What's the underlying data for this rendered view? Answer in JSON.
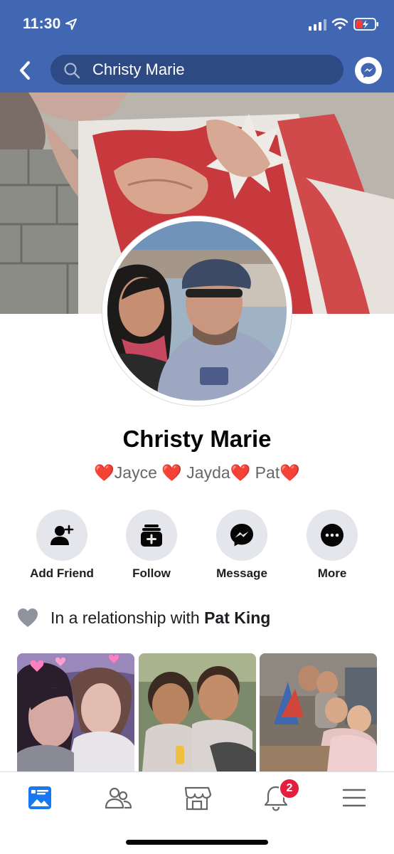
{
  "status_bar": {
    "time": "11:30"
  },
  "header": {
    "search_value": "Christy Marie"
  },
  "profile": {
    "name": "Christy Marie",
    "bio": "❤️Jayce ❤️ Jayda❤️ Pat❤️"
  },
  "actions": [
    {
      "label": "Add Friend",
      "icon": "add-friend-icon"
    },
    {
      "label": "Follow",
      "icon": "follow-icon"
    },
    {
      "label": "Message",
      "icon": "messenger-icon"
    },
    {
      "label": "More",
      "icon": "more-icon"
    }
  ],
  "relationship": {
    "prefix": "In a relationship with ",
    "partner": "Pat King"
  },
  "bottom_nav": {
    "items": [
      "profile-feed-icon",
      "friends-icon",
      "marketplace-icon",
      "notifications-icon",
      "menu-icon"
    ],
    "notifications_badge": "2"
  },
  "colors": {
    "brand": "#4267b2",
    "search_bg": "#2e4a85",
    "badge": "#e41e3f",
    "chip": "#e4e6eb"
  }
}
